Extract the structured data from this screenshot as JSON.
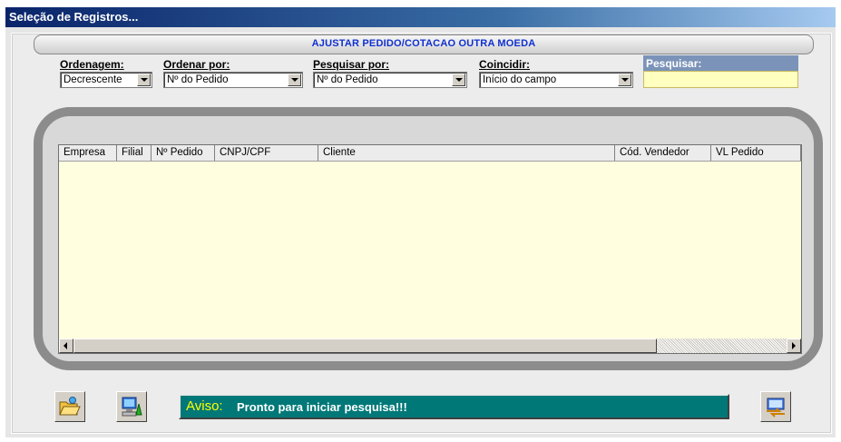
{
  "window": {
    "title": "Seleção de Registros..."
  },
  "banner": {
    "text": "AJUSTAR PEDIDO/COTACAO OUTRA MOEDA"
  },
  "filters": {
    "ordenagem": {
      "label": "Ordenagem:",
      "value": "Decrescente"
    },
    "ordenar_por": {
      "label": "Ordenar por:",
      "value": "Nº do Pedido"
    },
    "pesquisar_por": {
      "label": "Pesquisar por:",
      "value": "Nº do Pedido"
    },
    "coincidir": {
      "label": "Coincidir:",
      "value": "Início do campo"
    },
    "pesquisar": {
      "label": "Pesquisar:",
      "value": ""
    }
  },
  "grid": {
    "columns": [
      "Empresa",
      "Filial",
      "Nº Pedido",
      "CNPJ/CPF",
      "Cliente",
      "Cód. Vendedor",
      "VL Pedido"
    ],
    "rows": []
  },
  "status": {
    "key": "Aviso:",
    "message": "Pronto para iniciar pesquisa!!!"
  },
  "icons": {
    "open": "folder-open-icon",
    "report": "computer-report-icon",
    "transfer": "transfer-icon"
  },
  "colors": {
    "title_gradient_start": "#0a246a",
    "banner_text": "#1030d0",
    "grid_background": "#ffffdf",
    "status_background": "#007878",
    "status_key": "#ffff00"
  }
}
